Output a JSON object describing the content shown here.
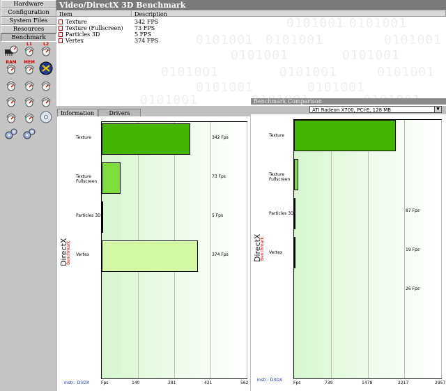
{
  "nav": {
    "items": [
      {
        "label": "Hardware"
      },
      {
        "label": "Configuration"
      },
      {
        "label": "System Files"
      },
      {
        "label": "Resources"
      },
      {
        "label": "Benchmark"
      }
    ],
    "tiles": [
      {
        "icon": "memory-chip-gauge-icon",
        "label": ""
      },
      {
        "icon": "l1-cache-gauge-icon",
        "label": "L1"
      },
      {
        "icon": "l2-cache-gauge-icon",
        "label": "L2"
      },
      {
        "icon": "ram-gauge-icon",
        "label": "RAM"
      },
      {
        "icon": "mem-gauge-icon",
        "label": "MEM"
      },
      {
        "icon": "directx-benchmark-icon",
        "label": ""
      },
      {
        "icon": "gauge-icon",
        "label": ""
      },
      {
        "icon": "gauge-icon",
        "label": ""
      },
      {
        "icon": "gauge-icon",
        "label": ""
      },
      {
        "icon": "gauge-icon",
        "label": ""
      },
      {
        "icon": "gauge-icon",
        "label": ""
      },
      {
        "icon": "gauge-icon",
        "label": ""
      },
      {
        "icon": "gauge-icon",
        "label": ""
      },
      {
        "icon": "gauge-icon",
        "label": ""
      },
      {
        "icon": "disc-icon",
        "label": ""
      },
      {
        "icon": "settings-gears-icon",
        "label": ""
      },
      {
        "icon": "network-gears-icon",
        "label": ""
      }
    ]
  },
  "header": {
    "title": "Video/DirectX 3D Benchmark"
  },
  "list": {
    "columns": [
      "Item",
      "Description"
    ],
    "rows": [
      {
        "item": "Texture",
        "desc": "342 FPS"
      },
      {
        "item": "Texture (Fullscreen)",
        "desc": "73 FPS"
      },
      {
        "item": "Particles 3D",
        "desc": "5 FPS"
      },
      {
        "item": "Vertex",
        "desc": "374 FPS"
      }
    ],
    "background_digits": "0101001"
  },
  "tabs": [
    {
      "label": "Information"
    },
    {
      "label": "Drivers"
    }
  ],
  "comparison": {
    "title": "Benchmark Comparison",
    "selected": "ATI Radeon X700, PCI-E, 128 MB"
  },
  "watermark": {
    "main": "DirectX",
    "sub": "Benchmark"
  },
  "instr": "Instr.: D3DX",
  "chart_data": [
    {
      "type": "bar",
      "orientation": "horizontal",
      "categories": [
        "Texture",
        "Texture Fullscreen",
        "Particles 3D",
        "Vertex"
      ],
      "values": [
        342,
        73,
        5,
        374
      ],
      "value_labels": [
        "342 Fps",
        "73 Fps",
        "5 Fps",
        "374 Fps"
      ],
      "xlim": [
        0,
        562
      ],
      "ticks": [
        "Fps",
        "140",
        "281",
        "421",
        "562"
      ],
      "colors": [
        "#44b500",
        "#7edd3a",
        "#ffffff",
        "#d4f7a6"
      ]
    },
    {
      "type": "bar",
      "orientation": "horizontal",
      "categories": [
        "Texture",
        "Texture Fullscreen",
        "Particles 3D",
        "Vertex"
      ],
      "values": [
        2040,
        87,
        19,
        26
      ],
      "value_labels": [
        "",
        "87 Fps",
        "19 Fps",
        "26 Fps"
      ],
      "xlim": [
        0,
        2957
      ],
      "ticks": [
        "Fps",
        "739",
        "1478",
        "2217",
        "2957"
      ],
      "colors": [
        "#44b500",
        "#7edd3a",
        "#ffffff",
        "#d4f7a6"
      ]
    }
  ],
  "colors": {
    "header_bg": "#7a7a7a",
    "instr": "#1a2fb5",
    "watermark_sub": "#d40000"
  }
}
